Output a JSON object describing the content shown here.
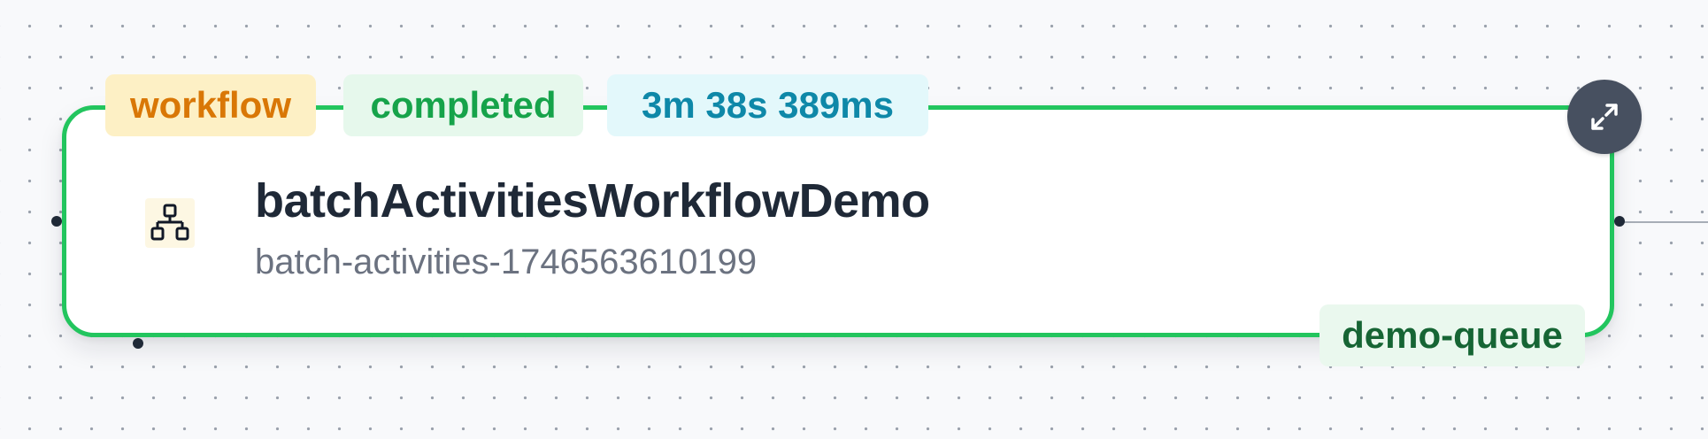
{
  "node": {
    "title": "batchActivitiesWorkflowDemo",
    "subtitle": "batch-activities-1746563610199",
    "icon": "workflow-hierarchy-icon",
    "border_color": "#22c55e"
  },
  "badges": {
    "type": {
      "label": "workflow",
      "bg": "#fdf0c5",
      "color": "#d97706"
    },
    "status": {
      "label": "completed",
      "bg": "#e6f8ec",
      "color": "#16a34a"
    },
    "duration": {
      "label": "3m 38s 389ms",
      "bg": "#e3f8fb",
      "color": "#0e88a8"
    },
    "queue": {
      "label": "demo-queue",
      "bg": "#eaf8ee",
      "color": "#166534"
    }
  },
  "controls": {
    "expand_icon": "expand-icon",
    "expand_bg": "#475060"
  }
}
